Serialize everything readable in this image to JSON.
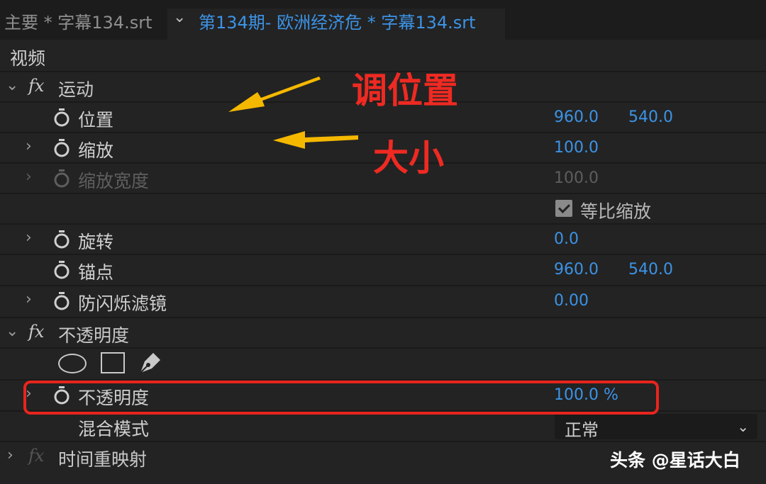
{
  "tabs": {
    "main_label": "主要 * 字幕134.srt",
    "sequence_label": "第134期- 欧洲经济危 * 字幕134.srt"
  },
  "section_title": "视频",
  "motion": {
    "label": "运动",
    "properties": {
      "position": {
        "label": "位置",
        "x": "960.0",
        "y": "540.0"
      },
      "scale": {
        "label": "缩放",
        "value": "100.0"
      },
      "scale_width": {
        "label": "缩放宽度",
        "value": "100.0"
      },
      "uniform_scale": {
        "label": "等比缩放",
        "checked": true
      },
      "rotation": {
        "label": "旋转",
        "value": "0.0"
      },
      "anchor": {
        "label": "锚点",
        "x": "960.0",
        "y": "540.0"
      },
      "anti_flicker": {
        "label": "防闪烁滤镜",
        "value": "0.00"
      }
    }
  },
  "opacity": {
    "label": "不透明度",
    "mask_tools": [
      "ellipse-mask-icon",
      "rectangle-mask-icon",
      "pen-mask-icon"
    ],
    "property": {
      "label": "不透明度",
      "value": "100.0 %"
    },
    "blend_mode": {
      "label": "混合模式",
      "selected": "正常"
    }
  },
  "time_remap": {
    "label": "时间重映射"
  },
  "annotations": {
    "position_note": "调位置",
    "scale_note": "大小"
  },
  "watermark": "头条 @星话大白",
  "colors": {
    "value_blue": "#3c93e6",
    "annotation_red": "#ee2a22",
    "arrow_yellow": "#f5b800",
    "background": "#232323"
  }
}
